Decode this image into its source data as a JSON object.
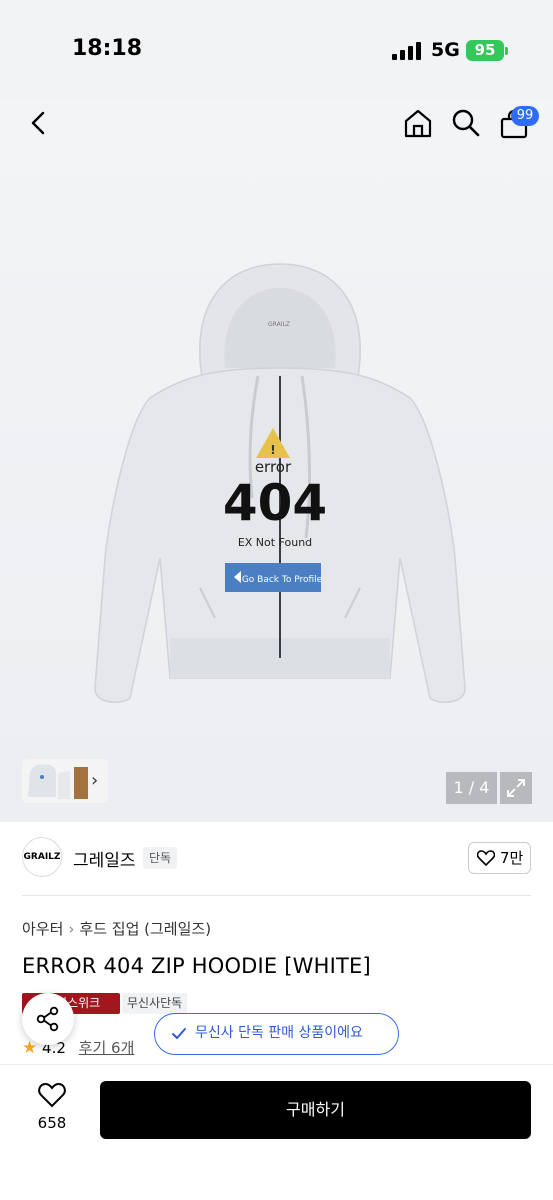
{
  "status_bar": {
    "time": "18:18",
    "network": "5G",
    "battery": "95"
  },
  "header": {
    "cart_count": "99"
  },
  "gallery": {
    "counter": "1 / 4",
    "print_error": "error",
    "print_code": "404",
    "print_not_found": "EX Not Found",
    "print_back": "Go Back To Profile",
    "collar_logo": "GRAILZ"
  },
  "brand": {
    "logo_text": "GRAILZ",
    "name": "그레일즈",
    "tag": "단독",
    "likes": "7만"
  },
  "breadcrumb": [
    "아우터",
    "후드 집업 (그레일즈)"
  ],
  "product": {
    "title": "ERROR 404 ZIP HOODIE [WHITE]",
    "badge_red": "컨스위크",
    "badge_gray": "무신사단독",
    "rating": "4.2",
    "reviews": "후기 6개"
  },
  "toast": {
    "text": "무신사 단독 판매 상품이에요"
  },
  "bottom_bar": {
    "wish_count": "658",
    "buy_label": "구매하기"
  },
  "colors": {
    "accent": "#2f5bd8",
    "badge_red": "#a2161e",
    "battery": "#34c759"
  }
}
